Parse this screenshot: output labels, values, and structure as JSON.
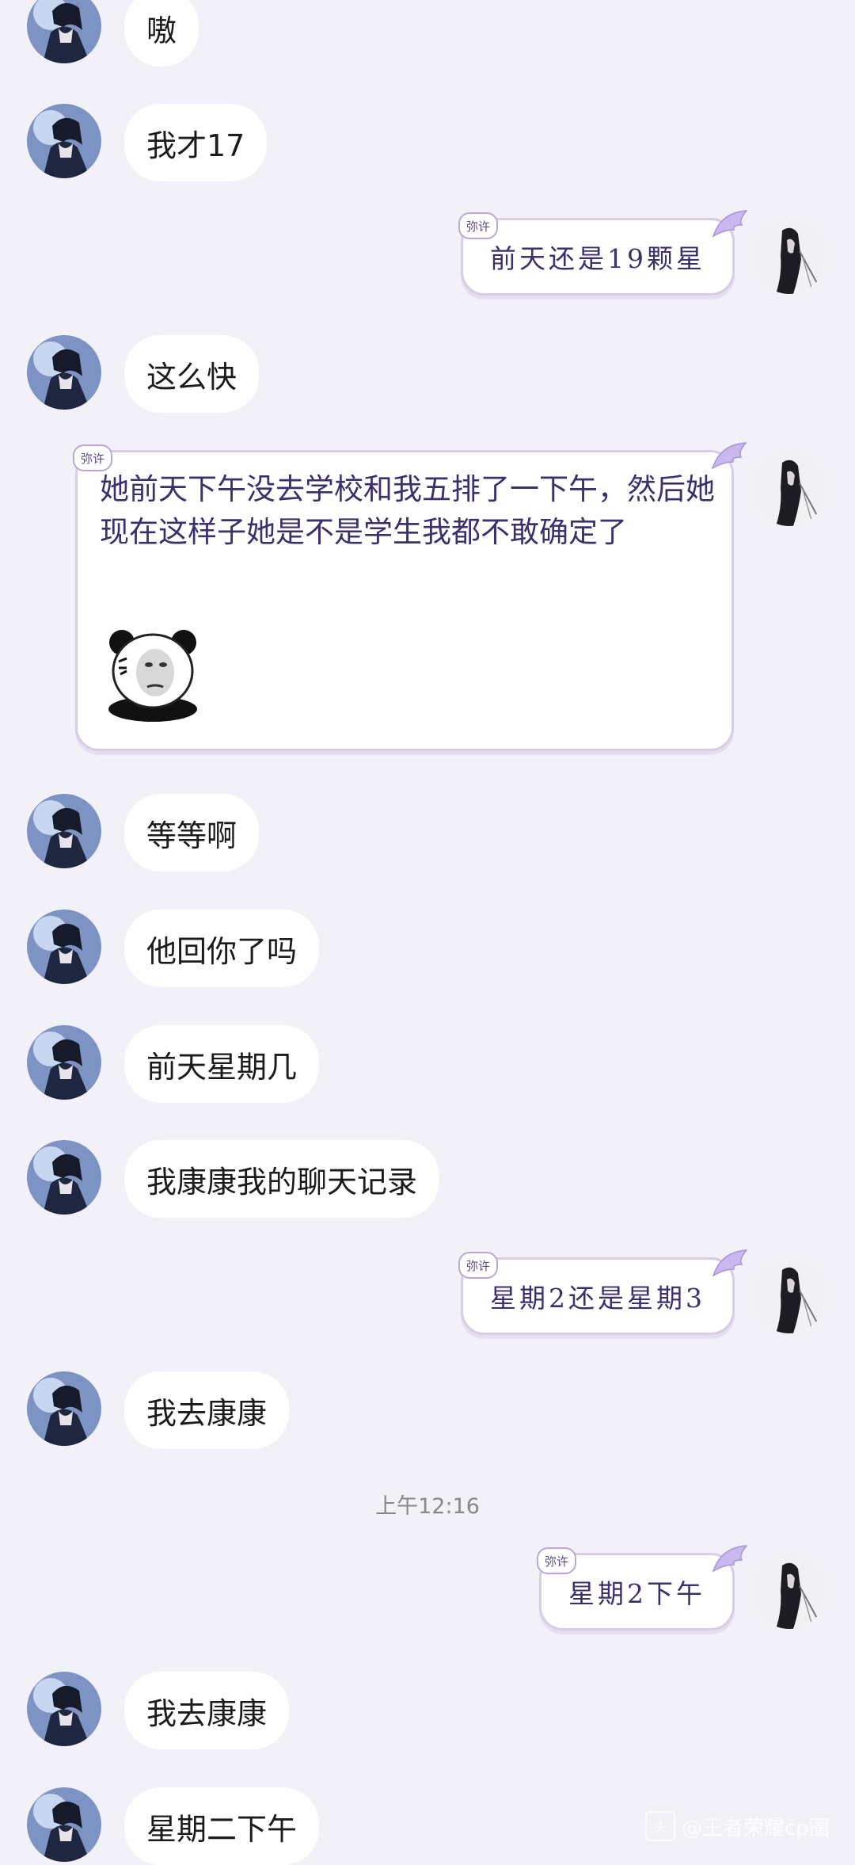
{
  "messages": [
    {
      "side": "left",
      "text": "嗷"
    },
    {
      "side": "left",
      "text": "我才17"
    },
    {
      "side": "right",
      "text": "前天还是19颗星"
    },
    {
      "side": "left",
      "text": "这么快"
    },
    {
      "side": "right_big",
      "text": "她前天下午没去学校和我五排了一下午，然后她现在这样子她是不是学生我都不敢确定了"
    },
    {
      "side": "left",
      "text": "等等啊"
    },
    {
      "side": "left",
      "text": "他回你了吗"
    },
    {
      "side": "left",
      "text": "前天星期几"
    },
    {
      "side": "left",
      "text": "我康康我的聊天记录"
    },
    {
      "side": "right",
      "text": "星期2还是星期3"
    },
    {
      "side": "left",
      "text": "我去康康"
    },
    {
      "side": "time",
      "text": "上午12:16"
    },
    {
      "side": "right",
      "text": "星期2下午"
    },
    {
      "side": "left",
      "text": "我去康康"
    },
    {
      "side": "left",
      "text": "星期二下午"
    }
  ],
  "bubble_tag": "弥许",
  "sticker": {
    "name": "panda-meme-sticker"
  },
  "watermark": {
    "icon_text": "头",
    "text": "@王者荣耀cp圈"
  },
  "colors": {
    "background": "#f3f1f8",
    "left_bubble": "#ffffff",
    "right_text": "#3d2f6e",
    "right_border": "#d8cde6"
  }
}
